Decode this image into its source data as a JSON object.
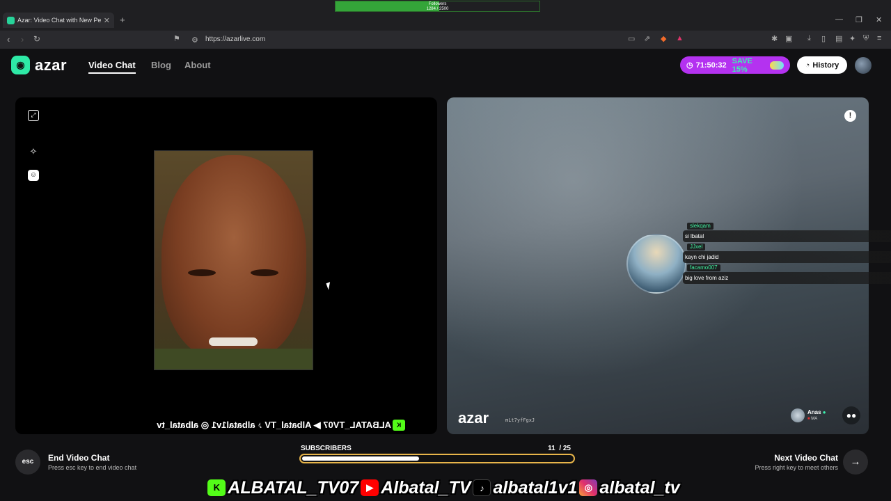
{
  "browser": {
    "tab_title": "Azar: Video Chat with New Pe",
    "tab_close": "✕",
    "new_tab": "+",
    "url": "https://azarlive.com",
    "minimize": "—",
    "restore": "❐",
    "close": "✕"
  },
  "followers_widget": {
    "label": "Followers",
    "current": "1284",
    "separator": "/",
    "goal": "2500",
    "progress": 0.51
  },
  "header": {
    "logo_text": "azar",
    "nav": [
      "Video Chat",
      "Blog",
      "About"
    ],
    "promo_timer": "71:50:32",
    "promo_save": "SAVE 15%",
    "history_label": "History"
  },
  "left_panel": {
    "tools": [
      "fullscreen-icon",
      "magic-wand-icon",
      "face-filter-icon"
    ],
    "stream_banner": "ALBATAL_TV07 ▶ Albatal_TV ♪ albatal1v1 ◎ albatal_tv"
  },
  "right_panel": {
    "watermark_logo": "azar",
    "watermark_code": "mLt7yfFgxJ",
    "peer_name": "Anas",
    "peer_country": "MA",
    "chat": [
      {
        "user": "slekqam",
        "message": "si lbatal"
      },
      {
        "user": "JJxel",
        "message": "kayn chi jadid"
      },
      {
        "user": "facamo007",
        "message": "big love from aziz"
      }
    ]
  },
  "bottom": {
    "esc_key": "esc",
    "end_title": "End Video Chat",
    "end_sub": "Press esc key to end video chat",
    "next_title": "Next Video Chat",
    "next_sub": "Press right key to meet others",
    "subs_label": "SUBSCRIBERS",
    "subs_count": "11",
    "subs_goal": "/ 25",
    "subs_progress": 0.44
  },
  "social": {
    "kick": "ALBATAL_TV07",
    "youtube": "Albatal_TV",
    "tiktok": "albatal1v1",
    "instagram": "albatal_tv"
  },
  "colors": {
    "accent": "#2ee9a6",
    "promo": "#b432f0",
    "followers_bar": "#34a539",
    "subs_border": "#e8b54a"
  }
}
